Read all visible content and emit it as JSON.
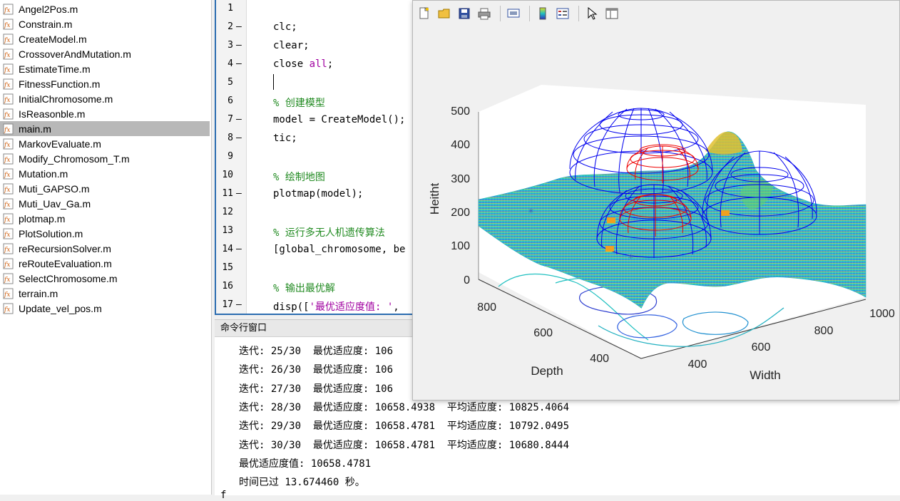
{
  "files": [
    {
      "name": "Angel2Pos.m"
    },
    {
      "name": "Constrain.m"
    },
    {
      "name": "CreateModel.m"
    },
    {
      "name": "CrossoverAndMutation.m"
    },
    {
      "name": "EstimateTime.m"
    },
    {
      "name": "FitnessFunction.m"
    },
    {
      "name": "InitialChromosome.m"
    },
    {
      "name": "IsReasonble.m"
    },
    {
      "name": "main.m",
      "selected": true
    },
    {
      "name": "MarkovEvaluate.m"
    },
    {
      "name": "Modify_Chromosom_T.m"
    },
    {
      "name": "Mutation.m"
    },
    {
      "name": "Muti_GAPSO.m"
    },
    {
      "name": "Muti_Uav_Ga.m"
    },
    {
      "name": "plotmap.m"
    },
    {
      "name": "PlotSolution.m"
    },
    {
      "name": "reRecursionSolver.m"
    },
    {
      "name": "reRouteEvaluation.m"
    },
    {
      "name": "SelectChromosome.m"
    },
    {
      "name": "terrain.m"
    },
    {
      "name": "Update_vel_pos.m"
    }
  ],
  "editor": {
    "line_numbers": [
      "1",
      "2",
      "3",
      "4",
      "5",
      "6",
      "7",
      "8",
      "9",
      "10",
      "11",
      "12",
      "13",
      "14",
      "15",
      "16",
      "17"
    ],
    "dash": "—",
    "lines": {
      "l2": "clc;",
      "l3": "clear;",
      "l4_a": "close ",
      "l4_b": "all",
      "l4_c": ";",
      "l6": "% 创建模型",
      "l7": "model = CreateModel();",
      "l8": "tic;",
      "l10": "% 绘制地图",
      "l11": "plotmap(model);",
      "l13": "% 运行多无人机遗传算法",
      "l14": "[global_chromosome, be",
      "l16": "% 输出最优解",
      "l17_a": "disp([",
      "l17_b": "'最优适应度值: '",
      "l17_c": ","
    }
  },
  "command_window": {
    "title": "命令行窗口",
    "lines": [
      "迭代: 25/30  最优适应度: 106",
      "迭代: 26/30  最优适应度: 106",
      "迭代: 27/30  最优适应度: 106",
      "迭代: 28/30  最优适应度: 10658.4938  平均适应度: 10825.4064",
      "迭代: 29/30  最优适应度: 10658.4781  平均适应度: 10792.0495",
      "迭代: 30/30  最优适应度: 10658.4781  平均适应度: 10680.8444",
      "最优适应度值: 10658.4781",
      "时间已过 13.674460 秒。"
    ],
    "prompt": "f"
  },
  "figure": {
    "toolbar": [
      "new-file-icon",
      "open-folder-icon",
      "save-icon",
      "print-icon",
      "link-figure-icon",
      "colorbar-icon",
      "legend-icon",
      "pointer-icon",
      "property-editor-icon"
    ],
    "plot": {
      "z_label": "Heitht",
      "x_label": "Width",
      "y_label": "Depth",
      "z_ticks": [
        "500",
        "400",
        "300",
        "200",
        "100",
        "0"
      ],
      "x_ticks": [
        "400",
        "600",
        "800",
        "1000"
      ],
      "y_ticks": [
        "800",
        "600",
        "400"
      ]
    }
  },
  "colors": {
    "threat_outer": "#0000ff",
    "threat_inner": "#ff0000",
    "surface_low": "#20c0e0",
    "surface_high": "#e0c020",
    "selection": "#b8b8b8",
    "editor_border": "#2b6cb0",
    "comment": "#228b22",
    "keyword": "#a000a0"
  }
}
